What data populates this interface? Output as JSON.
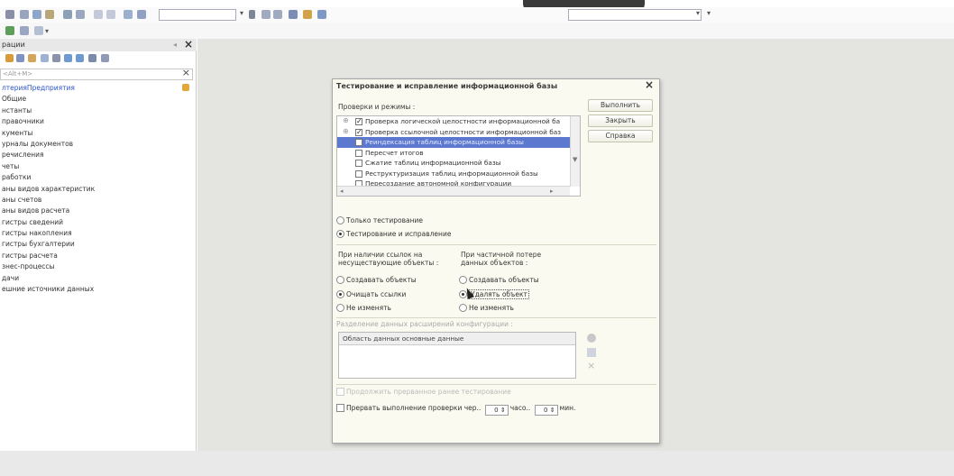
{
  "sidebar": {
    "title": "рации",
    "search_placeholder": "<Alt+M>",
    "items": [
      "лтерияПредприятия",
      "Общие",
      "нстанты",
      "правочники",
      "кументы",
      "урналы документов",
      "речисления",
      "четы",
      "работки",
      "аны видов характеристик",
      "аны счетов",
      "аны видов расчета",
      "гистры сведений",
      "гистры накопления",
      "гистры бухгалтерии",
      "гистры расчета",
      "знес-процессы",
      "дачи",
      "ешние источники данных"
    ]
  },
  "dialog": {
    "title": "Тестирование и исправление информационной базы",
    "buttons": {
      "run": "Выполнить",
      "close": "Закрыть",
      "help": "Справка"
    },
    "checks_label": "Проверки и режимы :",
    "checks": [
      {
        "label": "Проверка логической целостности информационной ба",
        "checked": true,
        "selected": false,
        "expandable": true
      },
      {
        "label": "Проверка ссылочной целостности информационной баз",
        "checked": true,
        "selected": false,
        "expandable": true
      },
      {
        "label": "Реиндексация таблиц информационной базы",
        "checked": false,
        "selected": true,
        "expandable": false
      },
      {
        "label": "Пересчет итогов",
        "checked": false,
        "selected": false,
        "expandable": false
      },
      {
        "label": "Сжатие таблиц информационной базы",
        "checked": false,
        "selected": false,
        "expandable": false
      },
      {
        "label": "Реструктуризация таблиц информационной базы",
        "checked": false,
        "selected": false,
        "expandable": false
      },
      {
        "label": "Пересоздание автономной конфигурации",
        "checked": false,
        "selected": false,
        "expandable": false
      }
    ],
    "mode": {
      "test_only": "Только тестирование",
      "test_and_fix": "Тестирование и исправление",
      "selected": "test_and_fix"
    },
    "missing_refs": {
      "label_line1": "При наличии ссылок на",
      "label_line2": "несуществующие объекты :",
      "create": "Создавать объекты",
      "clear": "Очищать ссылки",
      "nochange": "Не изменять",
      "selected": "clear"
    },
    "partial_loss": {
      "label_line1": "При частичной потере",
      "label_line2": "данных объектов :",
      "create": "Создавать объекты",
      "delete": "Удалять объект",
      "nochange": "Не изменять",
      "selected": "delete"
    },
    "ext_label": "Разделение данных расширений конфигурации :",
    "ext_column": "Область данных основные данные",
    "continue_label": "Продолжить прерванное ранее тестирование",
    "interrupt_label": "Прервать выполнение проверки чер..",
    "hours_value": "0",
    "hours_unit": "часо..",
    "minutes_value": "0",
    "minutes_unit": "мин."
  }
}
